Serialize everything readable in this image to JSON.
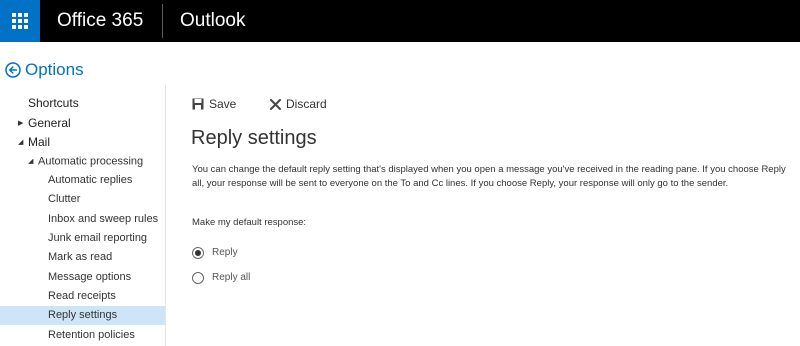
{
  "topbar": {
    "brand": "Office 365",
    "app_name": "Outlook",
    "waffle_icon": "app-launcher-icon",
    "waffle_color": "#0072c6"
  },
  "options": {
    "title": "Options",
    "back_icon": "back-arrow-icon"
  },
  "sidebar": {
    "items": [
      {
        "label": "Shortcuts",
        "level": 0,
        "caret": ""
      },
      {
        "label": "General",
        "level": 0,
        "caret": "collapsed"
      },
      {
        "label": "Mail",
        "level": 0,
        "caret": "expanded"
      },
      {
        "label": "Automatic processing",
        "level": 1,
        "caret": "expanded"
      },
      {
        "label": "Automatic replies",
        "level": 2,
        "caret": ""
      },
      {
        "label": "Clutter",
        "level": 2,
        "caret": ""
      },
      {
        "label": "Inbox and sweep rules",
        "level": 2,
        "caret": ""
      },
      {
        "label": "Junk email reporting",
        "level": 2,
        "caret": ""
      },
      {
        "label": "Mark as read",
        "level": 2,
        "caret": ""
      },
      {
        "label": "Message options",
        "level": 2,
        "caret": ""
      },
      {
        "label": "Read receipts",
        "level": 2,
        "caret": ""
      },
      {
        "label": "Reply settings",
        "level": 2,
        "caret": "",
        "selected": true
      },
      {
        "label": "Retention policies",
        "level": 2,
        "caret": ""
      }
    ],
    "selected_color": "#cde6f7"
  },
  "toolbar": {
    "save_label": "Save",
    "save_icon": "save-icon",
    "discard_label": "Discard",
    "discard_icon": "close-icon"
  },
  "main": {
    "title": "Reply settings",
    "description": "You can change the default reply setting that's displayed when you open a message you've received in the reading pane. If you choose Reply all, your response will be sent to everyone on the To and Cc lines. If you choose Reply, your response will only go to the sender.",
    "prompt": "Make my default response:",
    "options": [
      {
        "label": "Reply",
        "checked": true
      },
      {
        "label": "Reply all",
        "checked": false
      }
    ]
  }
}
